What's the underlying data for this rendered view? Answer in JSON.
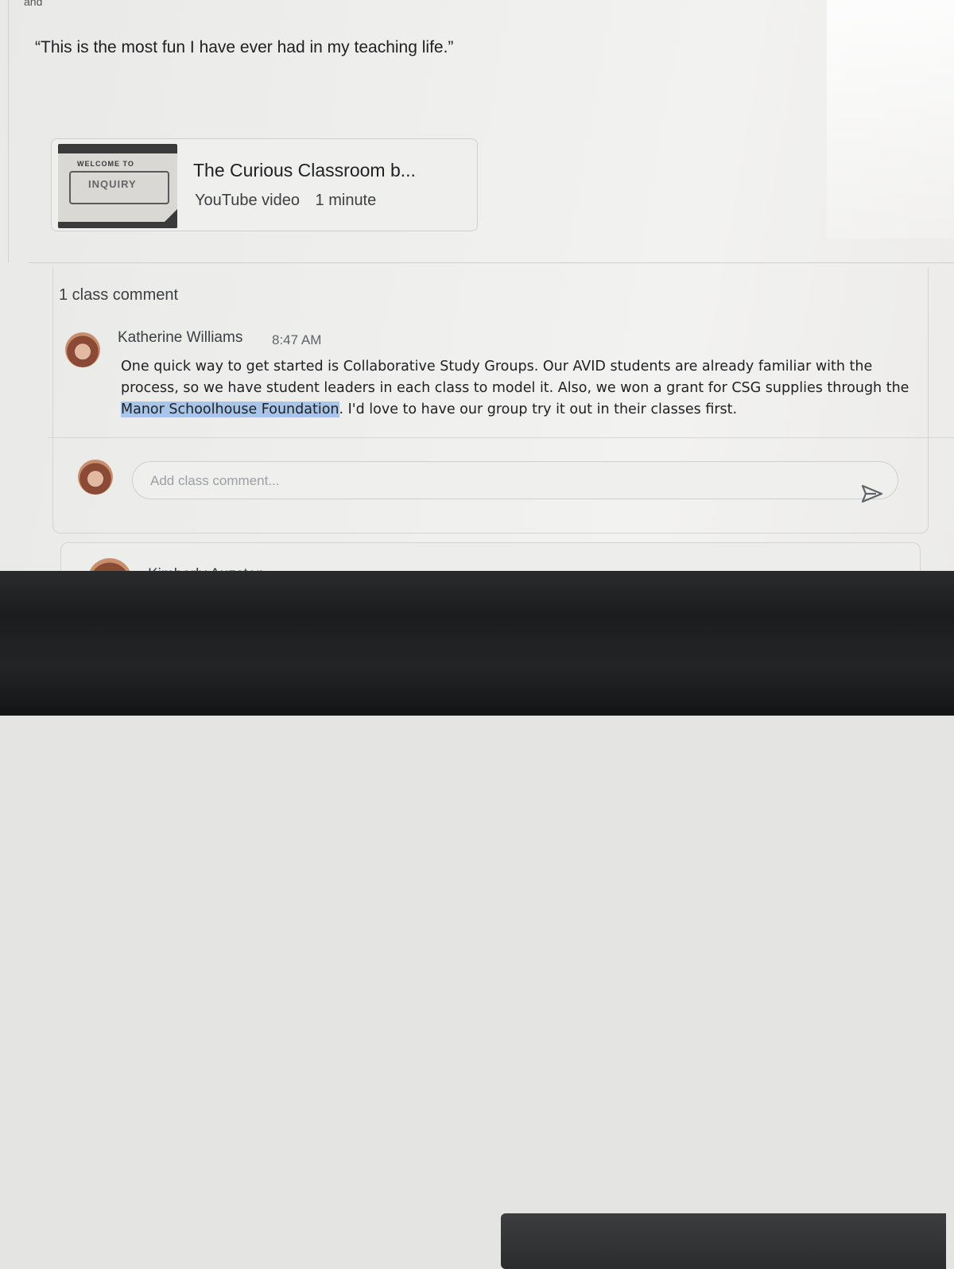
{
  "post": {
    "quote": "“This is the most fun I have ever had in my teaching life.”",
    "top_stub": "and"
  },
  "attachment": {
    "title": "The Curious Classroom b...",
    "type_label": "YouTube video",
    "duration": "1 minute",
    "thumbnail_text_top": "WELCOME TO",
    "thumbnail_text_main": "INQUIRY"
  },
  "comments": {
    "count_label": "1 class comment",
    "items": [
      {
        "author": "Katherine Williams",
        "time": "8:47 AM",
        "text_before": "One quick way to get started is Collaborative Study Groups. Our AVID students are already familiar with the process, so we have student leaders in each class to model it. Also, we won a grant for CSG supplies through the ",
        "highlighted": "Manor Schoolhouse Foundation",
        "text_after": ". I'd love to have our group try it out in their classes first."
      }
    ],
    "input": {
      "placeholder": "Add class comment...",
      "value": ""
    }
  },
  "next_post": {
    "author": "Kimberly Auzston"
  },
  "icons": [
    "send-icon",
    "avatar"
  ]
}
